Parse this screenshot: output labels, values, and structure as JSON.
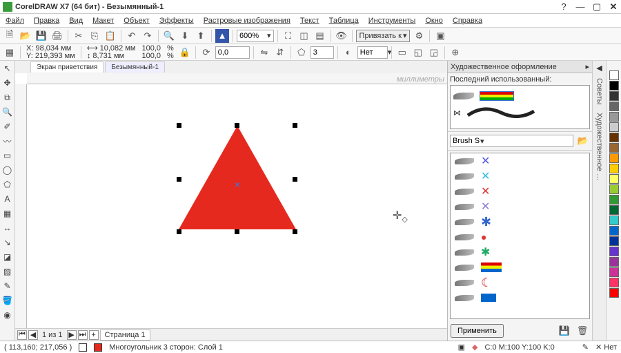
{
  "title": "CorelDRAW X7 (64 бит) - Безымянный-1",
  "menu": [
    "Файл",
    "Правка",
    "Вид",
    "Макет",
    "Объект",
    "Эффекты",
    "Растровые изображения",
    "Текст",
    "Таблица",
    "Инструменты",
    "Окно",
    "Справка"
  ],
  "zoom": "600%",
  "snap_label": "Привязать к",
  "coords": {
    "x_label": "X:",
    "x": "98,034 мм",
    "y_label": "Y:",
    "y": "219,393 мм",
    "w": "10,082 мм",
    "h": "8,731 мм",
    "sx": "100,0",
    "sy": "100,0",
    "pct": "%",
    "angle": "0,0",
    "sides": "3",
    "outline": "Нет"
  },
  "tabs": {
    "welcome": "Экран приветствия",
    "doc": "Безымянный-1"
  },
  "ruler_unit": "миллиметры",
  "page_nav": {
    "counter": "1 из 1",
    "tab": "Страница 1"
  },
  "docker": {
    "title": "Художественное оформление",
    "last_used": "Последний использованный:",
    "category": "Brush Strokes",
    "apply": "Применить"
  },
  "status": {
    "coords": "( 113,160; 217,056 )",
    "object": "Многоугольник  3 сторон: Слой 1",
    "cmyk": "C:0 M:100 Y:100 K:0",
    "none": "Нет"
  },
  "palette_colors": [
    "#ffffff",
    "#000000",
    "#333333",
    "#666666",
    "#999999",
    "#cccccc",
    "#663300",
    "#996633",
    "#ff9900",
    "#ffcc00",
    "#ffff66",
    "#99cc33",
    "#339933",
    "#006633",
    "#33cccc",
    "#0066cc",
    "#003399",
    "#6633cc",
    "#993399",
    "#cc3399",
    "#ff3366",
    "#ff0000"
  ]
}
